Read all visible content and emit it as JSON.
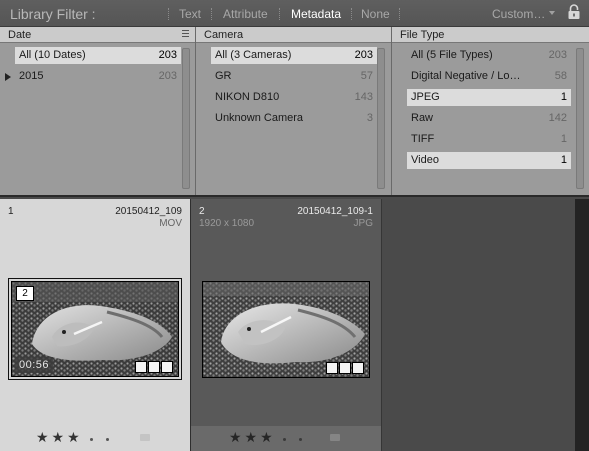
{
  "filter_bar": {
    "title": "Library Filter :",
    "tabs": [
      "Text",
      "Attribute",
      "Metadata",
      "None"
    ],
    "active_tab": "Metadata",
    "preset": "Custom…",
    "icons": [
      "chevron-down-icon",
      "lock-icon"
    ]
  },
  "metadata": {
    "date": {
      "header": "Date",
      "rows": [
        {
          "label": "All (10 Dates)",
          "count": "203"
        },
        {
          "label": "2015",
          "count": "203"
        }
      ]
    },
    "camera": {
      "header": "Camera",
      "rows": [
        {
          "label": "All (3 Cameras)",
          "count": "203"
        },
        {
          "label": "GR",
          "count": "57"
        },
        {
          "label": "NIKON D810",
          "count": "143"
        },
        {
          "label": "Unknown Camera",
          "count": "3"
        }
      ]
    },
    "file_type": {
      "header": "File Type",
      "rows": [
        {
          "label": "All (5 File Types)",
          "count": "203"
        },
        {
          "label": "Digital Negative / Lo…",
          "count": "58"
        },
        {
          "label": "JPEG",
          "count": "1"
        },
        {
          "label": "Raw",
          "count": "142"
        },
        {
          "label": "TIFF",
          "count": "1"
        },
        {
          "label": "Video",
          "count": "1"
        }
      ]
    }
  },
  "grid": {
    "cells": [
      {
        "index": "1",
        "name": "20150412_109",
        "type": "MOV",
        "badge": "2",
        "duration": "00:56",
        "rating": "★★★",
        "selected": true
      },
      {
        "index": "2",
        "name": "20150412_109-1",
        "dimensions": "1920 x 1080",
        "type": "JPG",
        "rating": "★★★",
        "selected": false
      }
    ]
  },
  "colors": {
    "panel_bg": "#9b9b9b",
    "selected_cell": "#d7d7d7",
    "grid_bg": "#4a4a4a"
  }
}
